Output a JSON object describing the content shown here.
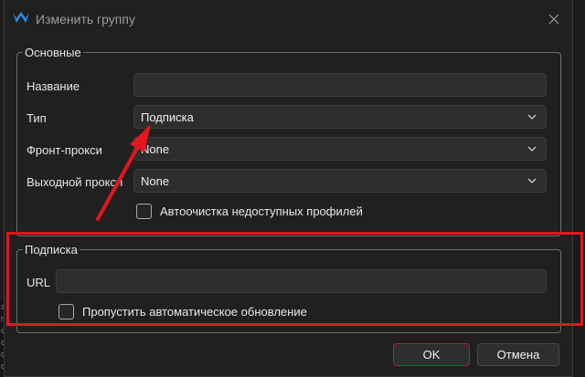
{
  "window": {
    "title": "Изменить группу"
  },
  "background": {
    "snippet_chars": [
      "э",
      "п",
      "с",
      "с",
      "с",
      "с"
    ]
  },
  "main_group": {
    "legend": "Основные",
    "name_label": "Название",
    "name_value": "",
    "type_label": "Тип",
    "type_value": "Подписка",
    "front_proxy_label": "Фронт-прокси",
    "front_proxy_value": "None",
    "exit_proxy_label": "Выходной прокси",
    "exit_proxy_value": "None",
    "autoclean_label": "Автоочистка недоступных профилей",
    "autoclean_checked": false
  },
  "subscription_group": {
    "legend": "Подписка",
    "url_label": "URL",
    "url_value": "",
    "skip_update_label": "Пропустить автоматическое обновление",
    "skip_update_checked": false
  },
  "buttons": {
    "ok": "OK",
    "cancel": "Отмена"
  },
  "colors": {
    "accent": "#e1161f",
    "logo": "#2f8be8"
  },
  "icons": [
    "app-logo-icon",
    "close-icon",
    "chevron-down-icon",
    "arrow-annotation-icon"
  ]
}
